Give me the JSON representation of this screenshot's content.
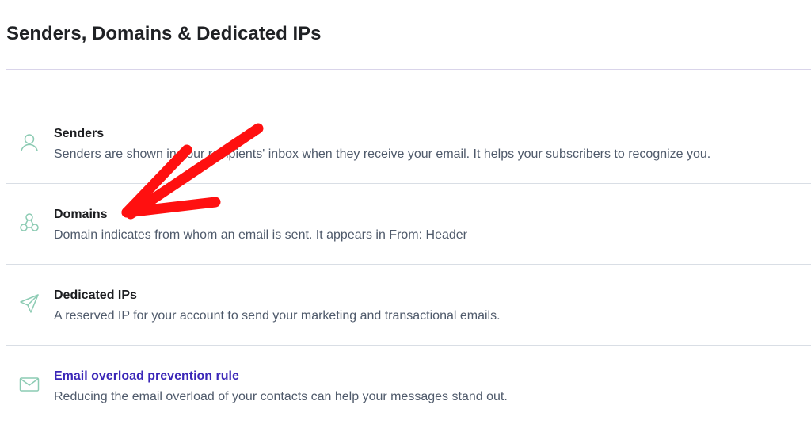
{
  "page": {
    "title": "Senders, Domains & Dedicated IPs"
  },
  "items": [
    {
      "title": "Senders",
      "description": "Senders are shown in your recipients' inbox when they receive your email. It helps your subscribers to recognize you.",
      "icon": "user-icon"
    },
    {
      "title": "Domains",
      "description": "Domain indicates from whom an email is sent. It appears in From: Header",
      "icon": "network-icon"
    },
    {
      "title": "Dedicated IPs",
      "description": "A reserved IP for your account to send your marketing and transactional emails.",
      "icon": "send-icon"
    },
    {
      "title": "Email overload prevention rule",
      "description": "Reducing the email overload of your contacts can help your messages stand out.",
      "icon": "envelope-icon"
    }
  ],
  "colors": {
    "icon": "#8ccbb3",
    "link": "#3b27b8",
    "annotation": "#ff1010"
  }
}
